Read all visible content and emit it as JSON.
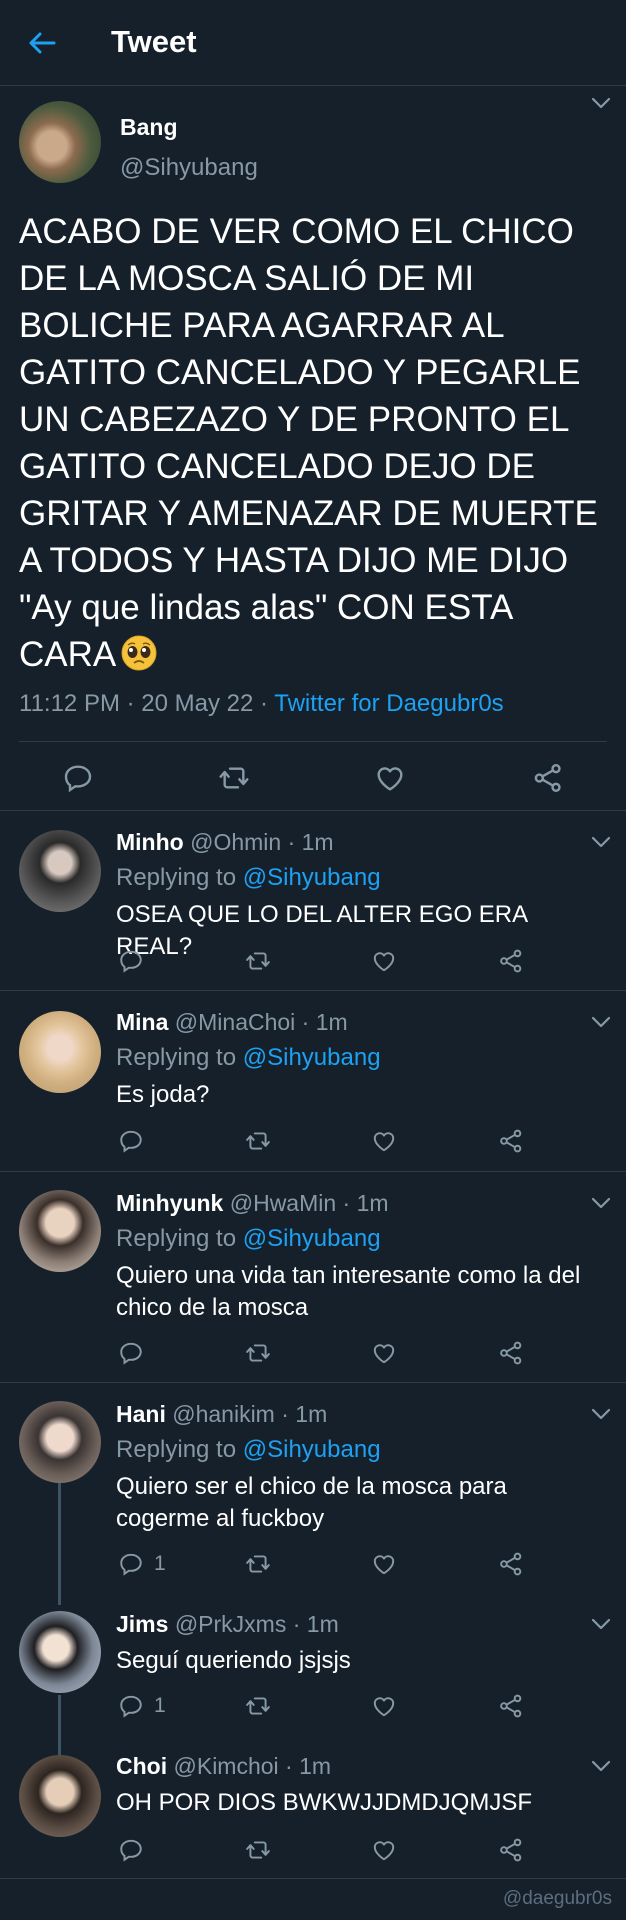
{
  "header": {
    "title": "Tweet",
    "back_icon": "arrow-left-icon"
  },
  "main_tweet": {
    "name": "Bang",
    "handle": "@Sihyubang",
    "text": "ACABO DE VER COMO EL CHICO DE LA MOSCA SALIÓ DE MI BOLICHE PARA AGARRAR AL GATITO CANCELADO Y PEGARLE UN CABEZAZO Y DE PRONTO EL GATITO CANCELADO DEJO DE GRITAR Y AMENAZAR DE MUERTE A TODOS Y HASTA DIJO ME DIJO \"Ay que lindas alas\" CON ESTA CARA",
    "emoji": "pleading-face-emoji",
    "time": "11:12 PM · 20 May 22 · ",
    "source": "Twitter for Daegubr0s"
  },
  "replies": [
    {
      "name": "Minho",
      "handle": "@Ohmin · 1m",
      "replying_label": "Replying to ",
      "replying_handle": "@Sihyubang",
      "text": "OSEA QUE LO DEL ALTER EGO ERA REAL?",
      "reply_count": ""
    },
    {
      "name": "Mina",
      "handle": "@MinaChoi · 1m",
      "replying_label": "Replying to ",
      "replying_handle": "@Sihyubang",
      "text": "Es joda?",
      "reply_count": ""
    },
    {
      "name": "Minhyunk",
      "handle": "@HwaMin · 1m",
      "replying_label": "Replying to ",
      "replying_handle": "@Sihyubang",
      "text": "Quiero una vida tan interesante como la del chico de la mosca",
      "reply_count": ""
    },
    {
      "name": "Hani",
      "handle": "@hanikim · 1m",
      "replying_label": "Replying to ",
      "replying_handle": "@Sihyubang",
      "text": "Quiero ser el chico de la mosca para cogerme al fuckboy",
      "reply_count": "1"
    },
    {
      "name": "Jims",
      "handle": "@PrkJxms · 1m",
      "text": "Seguí queriendo jsjsjs",
      "reply_count": "1"
    },
    {
      "name": "Choi",
      "handle": "@Kimchoi · 1m",
      "text": "OH POR DIOS BWKWJJDMDJQMJSF",
      "reply_count": ""
    }
  ],
  "watermark": "@daegubr0s",
  "colors": {
    "background": "#15202b",
    "accent": "#1da1f2",
    "muted": "#8899a6",
    "divider": "#2f3b47"
  }
}
